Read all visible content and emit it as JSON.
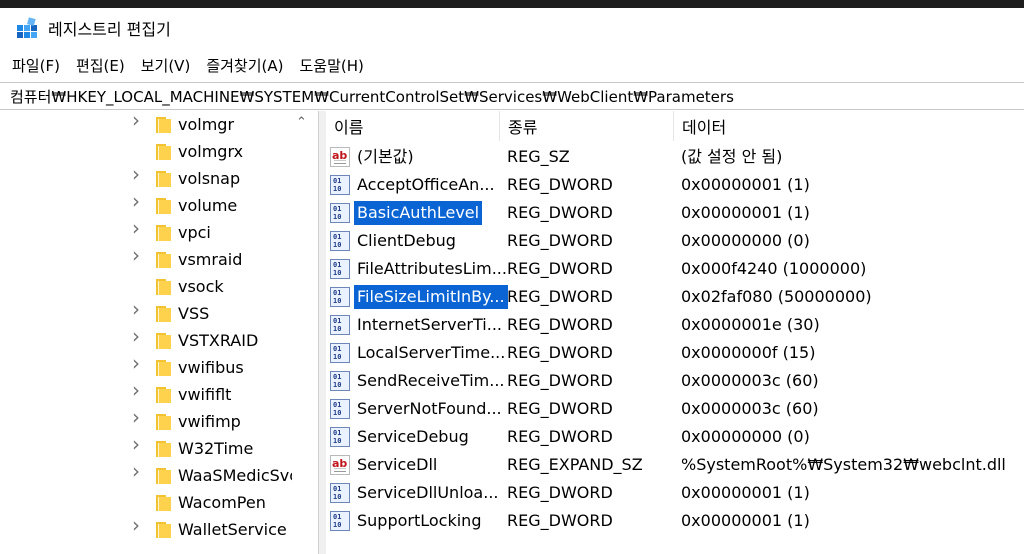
{
  "window": {
    "title": "레지스트리 편집기",
    "icon": "regedit-icon"
  },
  "menubar": {
    "items": [
      "파일(F)",
      "편집(E)",
      "보기(V)",
      "즐겨찾기(A)",
      "도움말(H)"
    ]
  },
  "address": {
    "path": "컴퓨터₩HKEY_LOCAL_MACHINE₩SYSTEM₩CurrentControlSet₩Services₩WebClient₩Parameters"
  },
  "tree": {
    "items": [
      {
        "label": "volmgr",
        "expandable": true
      },
      {
        "label": "volmgrx",
        "expandable": false
      },
      {
        "label": "volsnap",
        "expandable": true
      },
      {
        "label": "volume",
        "expandable": true
      },
      {
        "label": "vpci",
        "expandable": true
      },
      {
        "label": "vsmraid",
        "expandable": true
      },
      {
        "label": "vsock",
        "expandable": false
      },
      {
        "label": "VSS",
        "expandable": true
      },
      {
        "label": "VSTXRAID",
        "expandable": true
      },
      {
        "label": "vwifibus",
        "expandable": true
      },
      {
        "label": "vwififlt",
        "expandable": true
      },
      {
        "label": "vwifimp",
        "expandable": true
      },
      {
        "label": "W32Time",
        "expandable": true
      },
      {
        "label": "WaaSMedicSvc",
        "expandable": true
      },
      {
        "label": "WacomPen",
        "expandable": false
      },
      {
        "label": "WalletService",
        "expandable": true
      }
    ]
  },
  "list": {
    "columns": [
      "이름",
      "종류",
      "데이터"
    ],
    "rows": [
      {
        "icon": "string-value-icon",
        "name": "(기본값)",
        "type": "REG_SZ",
        "data": "(값 설정 안 됨)",
        "selected": false
      },
      {
        "icon": "binary-value-icon",
        "name": "AcceptOfficeAn...",
        "type": "REG_DWORD",
        "data": "0x00000001 (1)",
        "selected": false
      },
      {
        "icon": "binary-value-icon",
        "name": "BasicAuthLevel",
        "type": "REG_DWORD",
        "data": "0x00000001 (1)",
        "selected": true
      },
      {
        "icon": "binary-value-icon",
        "name": "ClientDebug",
        "type": "REG_DWORD",
        "data": "0x00000000 (0)",
        "selected": false
      },
      {
        "icon": "binary-value-icon",
        "name": "FileAttributesLim...",
        "type": "REG_DWORD",
        "data": "0x000f4240 (1000000)",
        "selected": false
      },
      {
        "icon": "binary-value-icon",
        "name": "FileSizeLimitInBy...",
        "type": "REG_DWORD",
        "data": "0x02faf080 (50000000)",
        "selected": true
      },
      {
        "icon": "binary-value-icon",
        "name": "InternetServerTi...",
        "type": "REG_DWORD",
        "data": "0x0000001e (30)",
        "selected": false
      },
      {
        "icon": "binary-value-icon",
        "name": "LocalServerTime...",
        "type": "REG_DWORD",
        "data": "0x0000000f (15)",
        "selected": false
      },
      {
        "icon": "binary-value-icon",
        "name": "SendReceiveTim...",
        "type": "REG_DWORD",
        "data": "0x0000003c (60)",
        "selected": false
      },
      {
        "icon": "binary-value-icon",
        "name": "ServerNotFound...",
        "type": "REG_DWORD",
        "data": "0x0000003c (60)",
        "selected": false
      },
      {
        "icon": "binary-value-icon",
        "name": "ServiceDebug",
        "type": "REG_DWORD",
        "data": "0x00000000 (0)",
        "selected": false
      },
      {
        "icon": "string-value-icon",
        "name": "ServiceDll",
        "type": "REG_EXPAND_SZ",
        "data": "%SystemRoot%₩System32₩webclnt.dll",
        "selected": false
      },
      {
        "icon": "binary-value-icon",
        "name": "ServiceDllUnloa...",
        "type": "REG_DWORD",
        "data": "0x00000001 (1)",
        "selected": false
      },
      {
        "icon": "binary-value-icon",
        "name": "SupportLocking",
        "type": "REG_DWORD",
        "data": "0x00000001 (1)",
        "selected": false
      }
    ]
  },
  "colors": {
    "selection": "#0a64d3",
    "folder": "#ffd24d"
  }
}
